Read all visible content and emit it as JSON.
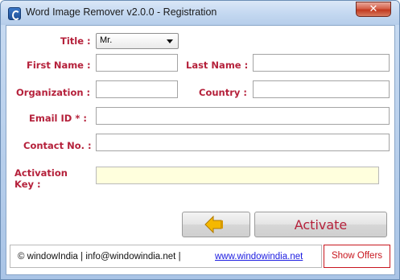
{
  "window": {
    "title": "Word Image Remover v2.0.0  -  Registration",
    "close_glyph": "✕"
  },
  "form": {
    "title_label": "Title :",
    "title_value": "Mr.",
    "first_name_label": "First Name :",
    "first_name_value": "",
    "last_name_label": "Last Name :",
    "last_name_value": "",
    "organization_label": "Organization :",
    "organization_value": "",
    "country_label": "Country :",
    "country_value": "",
    "email_label": "Email ID * :",
    "email_value": "",
    "contact_label": "Contact No. :",
    "contact_value": "",
    "activation_label_line1": "Activation",
    "activation_label_line2": "Key :",
    "activation_value": ""
  },
  "buttons": {
    "back_icon": "arrow-left-icon",
    "activate_label": "Activate",
    "show_offers_label": "Show Offers"
  },
  "footer": {
    "text": "© windowIndia  |  info@windowindia.net  |",
    "link": "www.windowindia.net"
  },
  "colors": {
    "label": "#b5213b",
    "activation_bg": "#ffffdd",
    "arrow_fill": "#f5b800",
    "link": "#1a1ae0",
    "offers_border": "#c8171f"
  }
}
